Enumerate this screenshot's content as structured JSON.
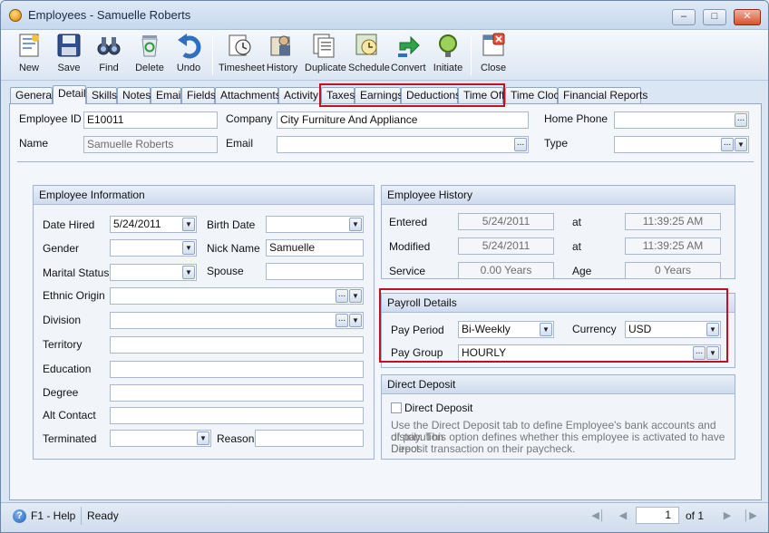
{
  "window": {
    "title": "Employees - Samuelle Roberts"
  },
  "toolbar": {
    "items": [
      {
        "label": "New",
        "icon": "new-document-icon"
      },
      {
        "label": "Save",
        "icon": "floppy-disk-icon"
      },
      {
        "label": "Find",
        "icon": "binoculars-icon"
      },
      {
        "label": "Delete",
        "icon": "recycle-bin-icon"
      },
      {
        "label": "Undo",
        "icon": "undo-arrow-icon"
      },
      {
        "label": "Timesheet",
        "icon": "timesheet-icon"
      },
      {
        "label": "History",
        "icon": "history-icon"
      },
      {
        "label": "Duplicate",
        "icon": "duplicate-icon"
      },
      {
        "label": "Schedule",
        "icon": "schedule-icon"
      },
      {
        "label": "Convert",
        "icon": "convert-icon"
      },
      {
        "label": "Initiate",
        "icon": "traffic-light-icon"
      },
      {
        "label": "Close",
        "icon": "close-window-icon"
      }
    ]
  },
  "tabs": [
    "General",
    "Detail",
    "Skills",
    "Notes",
    "Email",
    "Fields",
    "Attachments",
    "Activity",
    "Taxes",
    "Earnings",
    "Deductions",
    "Time Off",
    "Time Clock",
    "Financial Reports"
  ],
  "header": {
    "employee_id_label": "Employee ID",
    "employee_id": "E10011",
    "company_label": "Company",
    "company": "City Furniture And Appliance",
    "home_phone_label": "Home Phone",
    "home_phone": "",
    "name_label": "Name",
    "name": "Samuelle Roberts",
    "email_label": "Email",
    "email": "",
    "type_label": "Type",
    "type": ""
  },
  "employee_info": {
    "title": "Employee Information",
    "date_hired_label": "Date Hired",
    "date_hired": "5/24/2011",
    "birth_date_label": "Birth Date",
    "birth_date": "",
    "gender_label": "Gender",
    "gender": "",
    "nick_name_label": "Nick Name",
    "nick_name": "Samuelle",
    "marital_status_label": "Marital Status",
    "marital_status": "",
    "spouse_label": "Spouse",
    "spouse": "",
    "ethnic_origin_label": "Ethnic Origin",
    "division_label": "Division",
    "territory_label": "Territory",
    "education_label": "Education",
    "degree_label": "Degree",
    "alt_contact_label": "Alt Contact",
    "terminated_label": "Terminated",
    "terminated": "",
    "reason_label": "Reason",
    "reason": ""
  },
  "history": {
    "title": "Employee History",
    "entered_label": "Entered",
    "entered_date": "5/24/2011",
    "entered_time": "11:39:25 AM",
    "modified_label": "Modified",
    "modified_date": "5/24/2011",
    "modified_time": "11:39:25 AM",
    "at_label": "at",
    "service_label": "Service",
    "service": "0.00 Years",
    "age_label": "Age",
    "age": "0 Years"
  },
  "payroll": {
    "title": "Payroll Details",
    "pay_period_label": "Pay Period",
    "pay_period": "Bi-Weekly",
    "currency_label": "Currency",
    "currency": "USD",
    "pay_group_label": "Pay Group",
    "pay_group": "HOURLY"
  },
  "direct_deposit": {
    "title": "Direct Deposit",
    "checkbox_label": "Direct Deposit",
    "desc_line1": "Use the Direct Deposit tab to define Employee's bank accounts and distribution",
    "desc_line2": "of pay. This option defines whether this employee is activated to have Direct",
    "desc_line3": "Deposit transaction on their paycheck."
  },
  "status": {
    "help": "F1 - Help",
    "state": "Ready",
    "page": "1",
    "of_label": "of 1"
  },
  "colors": {
    "highlight": "#c1121c",
    "panel_header": "#cfdcee"
  }
}
